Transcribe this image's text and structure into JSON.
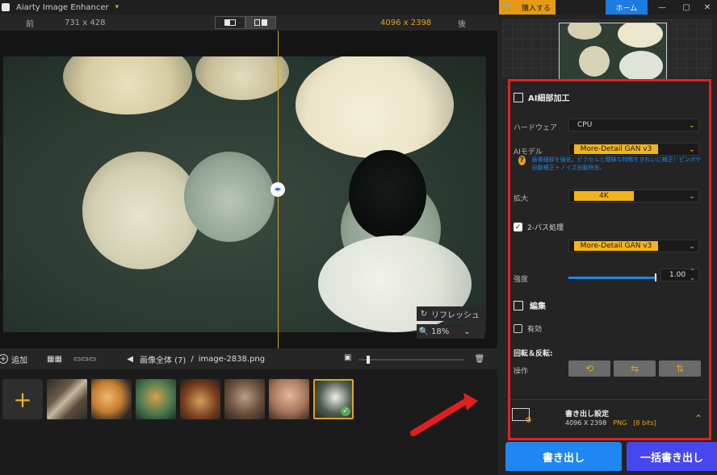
{
  "app": {
    "title": "Aiarty Image Enhancer"
  },
  "viewer": {
    "before_label": "前",
    "before_size": "731 x 428",
    "after_size": "4096 x 2398",
    "after_label": "後",
    "refresh_label": "リフレッシュ",
    "zoom_value": "18%"
  },
  "list": {
    "add_label": "追加",
    "breadcrumb_all": "画像全体 (7)",
    "breadcrumb_sep": "/",
    "current_file": "image-2838.png",
    "thumbnails_count": 7,
    "selected_index": 6
  },
  "right": {
    "buy_label": "購入する",
    "home_label": "ホーム"
  },
  "panel": {
    "ai_detail_title": "AI細部加工",
    "hardware_label": "ハードウェア",
    "hardware_value": "CPU",
    "ai_model_label": "AIモデル",
    "ai_model_value": "More-Detail GAN  v3",
    "ai_model_hint": "画像細部を強化。ピクセルと曖昧な特徴をきれいに補正！ピンボケ自動補正＋ノイズ自動除去。",
    "upscale_label": "拡大",
    "upscale_value": "4K",
    "twopass_label": "2-パス処理",
    "twopass_model_value": "More-Detail GAN  v3",
    "strength_label": "強度",
    "strength_value": "1.00",
    "strength_fraction": 0.98,
    "edit_title": "編集",
    "enable_label": "有効",
    "rotate_flip_title": "回転＆反転:",
    "operation_label": "操作",
    "export_settings_title": "書き出し設定",
    "export_size": "4096 X 2398",
    "export_format": "PNG",
    "export_bits": "[8 bits]"
  },
  "buttons": {
    "export_label": "書き出し",
    "batch_export_label": "一括書き出し"
  },
  "colors": {
    "accent_yellow": "#f2b41b",
    "accent_blue": "#1f86f2",
    "accent_purple": "#4747f0",
    "highlight_red": "#e61f1f"
  }
}
